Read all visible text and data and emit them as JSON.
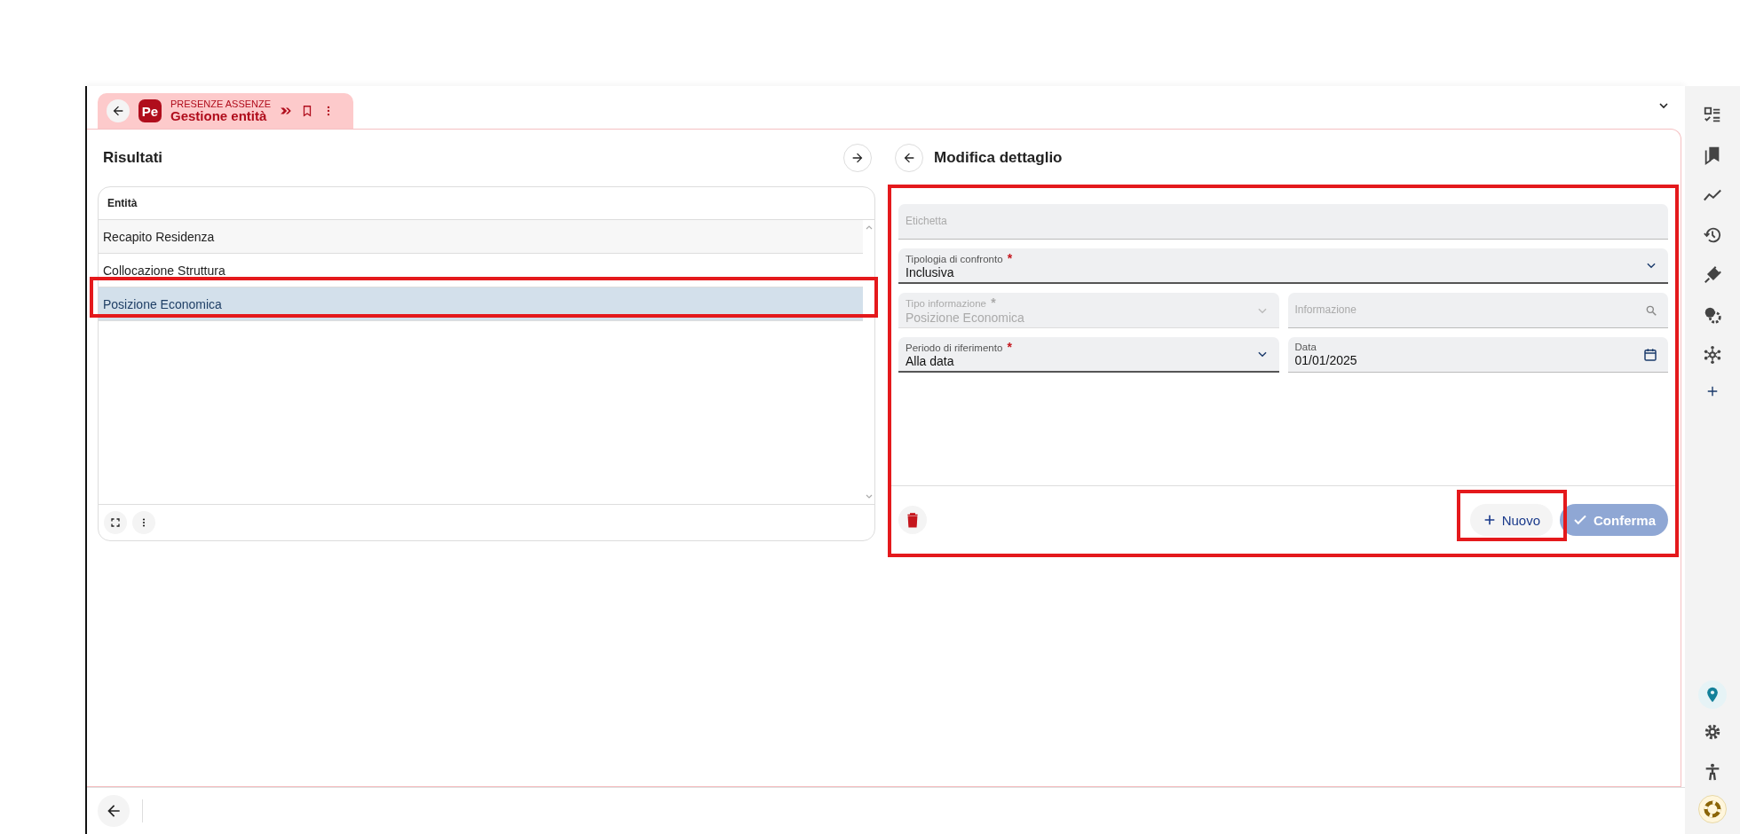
{
  "tab": {
    "module": "PRESENZE ASSENZE",
    "title": "Gestione entità",
    "logo": "Pe"
  },
  "results": {
    "title": "Risultati",
    "column": "Entità",
    "rows": [
      {
        "label": "Recapito Residenza",
        "selected": false
      },
      {
        "label": "Collocazione Struttura",
        "selected": false
      },
      {
        "label": "Posizione Economica",
        "selected": true
      }
    ]
  },
  "detail": {
    "title": "Modifica dettaglio",
    "fields": [
      {
        "kind": "text",
        "label": "Etichetta",
        "disabled": false,
        "wide": true
      },
      {
        "kind": "select",
        "label": "Tipologia di confronto",
        "value": "Inclusiva",
        "required_mark": "*",
        "disabled": false,
        "wide": true
      },
      {
        "kind": "select",
        "label": "Tipo informazione",
        "value": "Posizione Economica",
        "required_mark": "*",
        "disabled": true,
        "wide": false
      },
      {
        "kind": "search",
        "label": "Informazione",
        "disabled": false,
        "wide": false
      },
      {
        "kind": "select",
        "label": "Periodo di riferimento",
        "value": "Alla data",
        "required_mark": "*",
        "disabled": false,
        "wide": false
      },
      {
        "kind": "date",
        "label": "Data",
        "value": "01/01/2025",
        "disabled": false,
        "wide": false
      }
    ],
    "buttons": [
      {
        "label": "Nuovo",
        "kind": "add",
        "disabled": false
      },
      {
        "label": "Conferma",
        "kind": "confirm",
        "disabled": true
      }
    ]
  }
}
